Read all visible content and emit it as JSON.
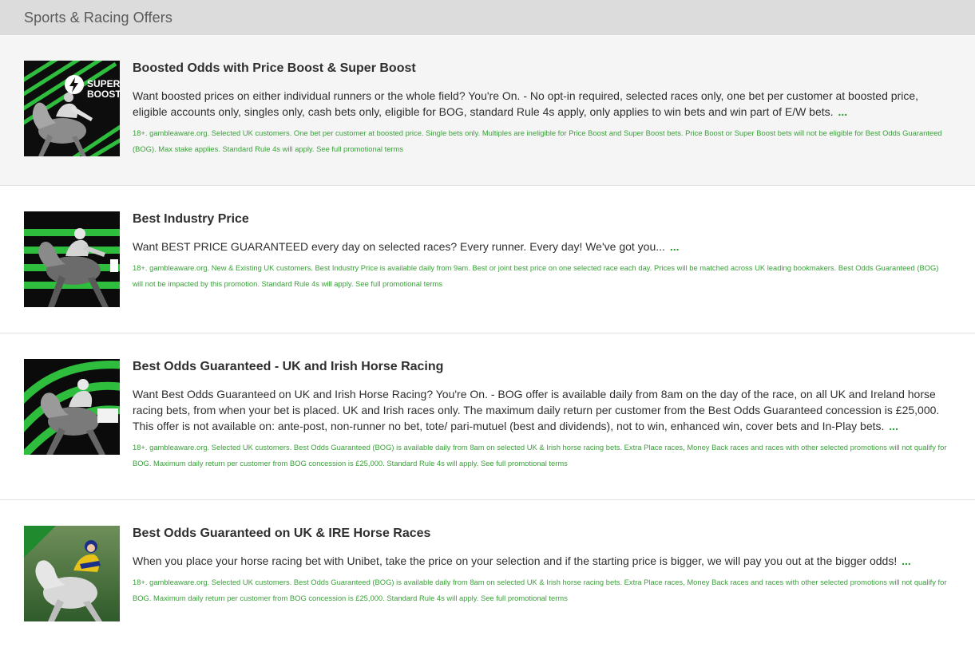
{
  "header": {
    "title": "Sports & Racing Offers"
  },
  "offers": [
    {
      "title": "Boosted Odds with Price Boost & Super Boost",
      "description": "Want boosted prices on either individual runners or the whole field? You're On. - No opt-in required, selected races only, one bet per customer at boosted price, eligible accounts only, singles only, cash bets only, eligible for BOG, standard Rule 4s apply, only applies to win bets and win part of E/W bets.",
      "more": "...",
      "terms": "18+. gambleaware.org. Selected UK customers. One bet per customer at boosted price. Single bets only. Multiples are ineligible for Price Boost and Super Boost bets. Price Boost or Super Boost bets will not be eligible for Best Odds Guaranteed (BOG). Max stake applies. Standard Rule 4s will apply. See full promotional terms",
      "image_text": "SUPER BOOST",
      "image_line1": "SUPER",
      "image_line2": "BOOST"
    },
    {
      "title": "Best Industry Price",
      "description": "Want BEST PRICE GUARANTEED every day on selected races? Every runner. Every day! We've got you...",
      "more": "...",
      "terms": "18+. gambleaware.org. New & Existing UK customers. Best Industry Price is available daily from 9am. Best or joint best price on one selected race each day. Prices will be matched across UK leading bookmakers. Best Odds Guaranteed (BOG) will not be impacted by this promotion. Standard Rule 4s will apply. See full promotional terms"
    },
    {
      "title": "Best Odds Guaranteed - UK and Irish Horse Racing",
      "description": "Want Best Odds Guaranteed on UK and Irish Horse Racing? You're On. - BOG offer is available daily from 8am on the day of the race, on all UK and Ireland horse racing bets, from when your bet is placed. UK and Irish races only. The maximum daily return per customer from the Best Odds Guaranteed concession is £25,000. This offer is not available on: ante-post, non-runner no bet, tote/ pari-mutuel (best and dividends), not to win, enhanced win, cover bets and In-Play bets.",
      "more": "...",
      "terms": "18+. gambleaware.org. Selected UK customers. Best Odds Guaranteed (BOG) is available daily from 8am on selected UK & Irish horse racing bets. Extra Place races, Money Back races and races with other selected promotions will not qualify for BOG. Maximum daily return per customer from BOG concession is £25,000. Standard Rule 4s will apply. See full promotional terms"
    },
    {
      "title": "Best Odds Guaranteed on UK & IRE Horse Races",
      "description": "When you place your horse racing bet with Unibet, take the price on your selection and if the starting price is bigger, we will pay you out at the bigger odds!",
      "more": "...",
      "terms": "18+. gambleaware.org. Selected UK customers. Best Odds Guaranteed (BOG) is available daily from 8am on selected UK & Irish horse racing bets. Extra Place races, Money Back races and races with other selected promotions will not qualify for BOG. Maximum daily return per customer from BOG concession is £25,000. Standard Rule 4s will apply. See full promotional terms"
    }
  ],
  "colors": {
    "header_bg": "#dcdcdc",
    "brand_green": "#2ebd3c",
    "terms_green": "#3aa13a",
    "more_green": "#2a9a2a"
  }
}
